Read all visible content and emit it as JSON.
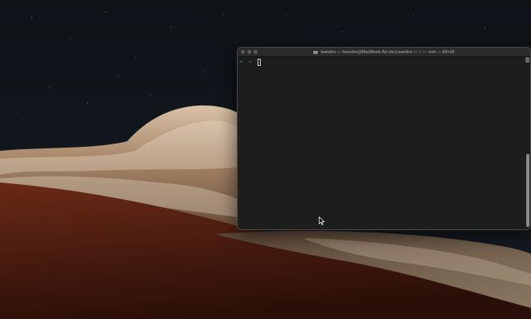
{
  "desktop": {
    "wallpaper": "macos-white-cliffs-night"
  },
  "terminal": {
    "title": "leandro — leandro@MacBook-Air-de-Leandro — ~ — -zsh — 63×19",
    "prompt_symbol": "➜",
    "cwd": "~",
    "colors": {
      "background": "#1d1d1d",
      "prompt_arrow": "#3ec16a",
      "cwd": "#39b7c6"
    }
  },
  "icons": {
    "folder": "folder-icon",
    "pointer": "mouse-pointer-icon"
  }
}
